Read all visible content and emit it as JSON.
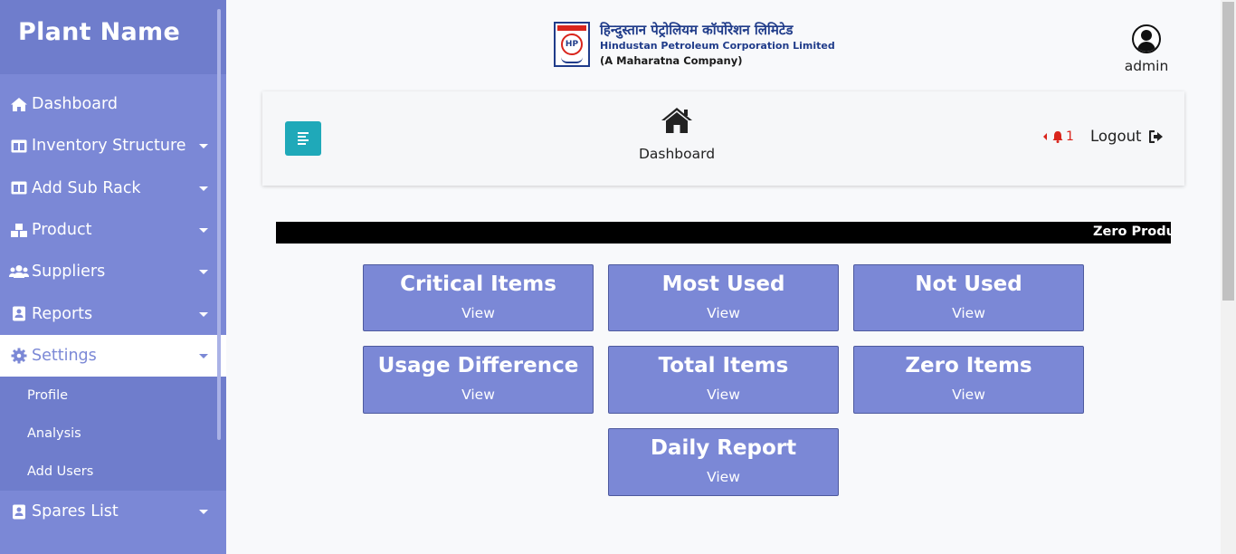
{
  "sidebar": {
    "brand": "Plant Name",
    "items": [
      {
        "label": "Dashboard",
        "icon": "home-icon"
      },
      {
        "label": "Inventory Structure",
        "icon": "columns-icon"
      },
      {
        "label": "Add Sub Rack",
        "icon": "columns-icon"
      },
      {
        "label": "Product",
        "icon": "boxes-icon"
      },
      {
        "label": "Suppliers",
        "icon": "users-icon"
      },
      {
        "label": "Reports",
        "icon": "address-book-icon"
      },
      {
        "label": "Settings",
        "icon": "gear-icon"
      },
      {
        "label": "Spares List",
        "icon": "address-book-icon"
      }
    ],
    "settings_sub": [
      {
        "label": "Profile"
      },
      {
        "label": "Analysis"
      },
      {
        "label": "Add Users"
      }
    ]
  },
  "header": {
    "logo": {
      "hindi": "हिन्दुस्तान पेट्रोलियम कॉर्पोरेशन लिमिटेड",
      "english": "Hindustan Petroleum Corporation Limited",
      "tagline": "(A Maharatna Company)",
      "badge": "HP"
    },
    "user": {
      "name": "admin"
    }
  },
  "topbar": {
    "page_label": "Dashboard",
    "notification_count": "1",
    "logout_label": "Logout"
  },
  "ticker": {
    "text": "Zero Produ"
  },
  "cards": [
    {
      "title": "Critical Items",
      "action": "View"
    },
    {
      "title": "Most Used",
      "action": "View"
    },
    {
      "title": "Not Used",
      "action": "View"
    },
    {
      "title": "Usage Difference",
      "action": "View"
    },
    {
      "title": "Total Items",
      "action": "View"
    },
    {
      "title": "Zero Items",
      "action": "View"
    },
    {
      "title": "Daily Report",
      "action": "View"
    }
  ],
  "colors": {
    "sidebar": "#7b88d6",
    "toggle": "#1fa9b9",
    "alert": "#d9251c",
    "brand_blue": "#203c8a"
  }
}
